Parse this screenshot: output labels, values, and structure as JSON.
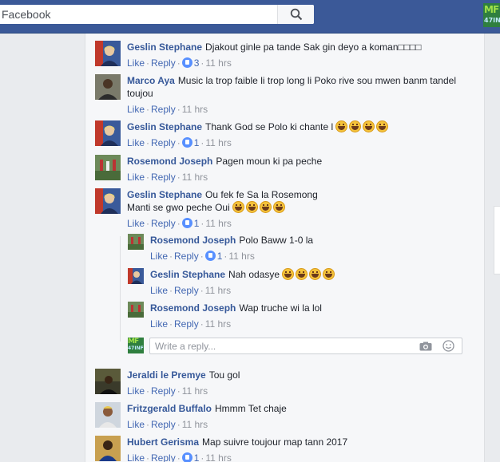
{
  "header": {
    "search_placeholder": "Facebook",
    "logo_line1": "MF",
    "logo_line2": "47INF"
  },
  "reply_box": {
    "placeholder": "Write a reply...",
    "avatar_line1": "MF",
    "avatar_line2": "47INF"
  },
  "comments": [
    {
      "author": "Geslin Stephane",
      "text": "Djakout ginle pa tande Sak gin deyo a koman□□□□",
      "emojis": 0,
      "like": "Like",
      "reply": "Reply",
      "reactions": "3",
      "time": "11 hrs"
    },
    {
      "author": "Marco Aya",
      "text": "Music la trop faible li trop long li Poko rive sou mwen banm tandel toujou",
      "emojis": 0,
      "like": "Like",
      "reply": "Reply",
      "reactions": "",
      "time": "11 hrs"
    },
    {
      "author": "Geslin Stephane",
      "text": "Thank God se Polo ki chante l",
      "emojis": 4,
      "like": "Like",
      "reply": "Reply",
      "reactions": "1",
      "time": "11 hrs"
    },
    {
      "author": "Rosemond Joseph",
      "text": "Pagen moun ki pa peche",
      "emojis": 0,
      "like": "Like",
      "reply": "Reply",
      "reactions": "",
      "time": "11 hrs"
    },
    {
      "author": "Geslin Stephane",
      "text": "Ou fek fe Sa la Rosemong",
      "text2": "Manti se gwo peche Oui",
      "emojis": 4,
      "like": "Like",
      "reply": "Reply",
      "reactions": "1",
      "time": "11 hrs"
    },
    {
      "author": "Rosemond Joseph",
      "text": "Polo Baww 1-0 la",
      "emojis": 0,
      "like": "Like",
      "reply": "Reply",
      "reactions": "1",
      "time": "11 hrs"
    },
    {
      "author": "Geslin Stephane",
      "text": "Nah odasye",
      "emojis": 4,
      "like": "Like",
      "reply": "Reply",
      "reactions": "",
      "time": "11 hrs"
    },
    {
      "author": "Rosemond Joseph",
      "text": "Wap truche wi la lol",
      "emojis": 0,
      "like": "Like",
      "reply": "Reply",
      "reactions": "",
      "time": "11 hrs"
    },
    {
      "author": "Jeraldi le Premye",
      "text": "Tou gol",
      "emojis": 0,
      "like": "Like",
      "reply": "Reply",
      "reactions": "",
      "time": "11 hrs"
    },
    {
      "author": "Fritzgerald Buffalo",
      "text": "Hmmm Tet chaje",
      "emojis": 0,
      "like": "Like",
      "reply": "Reply",
      "reactions": "",
      "time": "11 hrs"
    },
    {
      "author": "Hubert Gerisma",
      "text": "Map suivre toujour map tann 2017",
      "emojis": 0,
      "like": "Like",
      "reply": "Reply",
      "reactions": "1",
      "time": "11 hrs"
    }
  ],
  "colors": {
    "topbar": "#3b5998",
    "link": "#4267b2",
    "author": "#365899",
    "meta": "#90949c",
    "card_bg": "#f6f7f9"
  }
}
